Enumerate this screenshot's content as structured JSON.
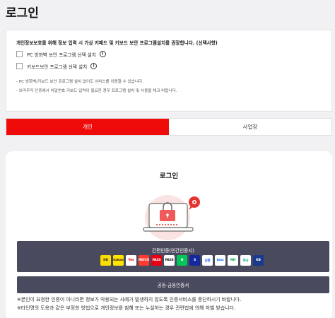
{
  "page": {
    "title": "로그인"
  },
  "notice": {
    "headline": "개인정보보호를 위해 정보 입력 시 가상 키패드 및 키보드 보안 프로그램설치를 권장합니다. (선택사항)",
    "options": [
      {
        "label": "PC 방화벽 보안 프로그램 선택 설치",
        "checked": false
      },
      {
        "label": "키보드보안 프로그램 선택 설치",
        "checked": false
      }
    ],
    "info_icon": "info-circle-icon",
    "bullets": [
      "- PC 방화벽/키보드 보안 프로그램 설치 없이도 서비스를 이용할 수 있습니다.",
      "- 브라우저 인증에서 비밀번호 키보드 입력이 필요한 경우 프로그램 설치 및 사용을 체크 바랍니다."
    ]
  },
  "tabs": [
    {
      "label": "개인",
      "active": true
    },
    {
      "label": "사업장",
      "active": false
    }
  ],
  "login": {
    "heading": "로그인",
    "illustration_icon": "laptop-lock-icon",
    "simple_auth": {
      "label": "간편인증(민간인증서)",
      "providers": [
        {
          "name": "KB",
          "bg": "#fbdc00",
          "fg": "#333"
        },
        {
          "name": "kakao",
          "bg": "#fee500",
          "fg": "#3c1e1e"
        },
        {
          "name": "Yes",
          "bg": "#ffffff",
          "fg": "#e60012"
        },
        {
          "name": "PAYCO",
          "bg": "#ff3b30",
          "fg": "#ffffff"
        },
        {
          "name": "PASS",
          "bg": "#e60012",
          "fg": "#ffffff"
        },
        {
          "name": "PASS",
          "bg": "#ffffff",
          "fg": "#222"
        },
        {
          "name": "N",
          "bg": "#03c75a",
          "fg": "#ffffff"
        },
        {
          "name": "S",
          "bg": "#1428a0",
          "fg": "#ffffff"
        },
        {
          "name": "신한",
          "bg": "#ffffff",
          "fg": "#0046ff"
        },
        {
          "name": "toss",
          "bg": "#ffffff",
          "fg": "#0064ff"
        },
        {
          "name": "NH",
          "bg": "#ffffff",
          "fg": "#00a651"
        },
        {
          "name": "하나",
          "bg": "#ffffff",
          "fg": "#00a37a"
        },
        {
          "name": "KB",
          "bg": "#1a3a8f",
          "fg": "#ffffff"
        }
      ]
    },
    "cert_auth": {
      "label": "공동·금융인증서"
    },
    "warnings": [
      "※본인이 요청한 인증이 아니라면 정보가 악용되는 사례가 발생하지 않도록 인증서비스를 중단하시기 바랍니다.",
      "※타인명의 도용과 같은 부정한 방법으로 개인정보를 침해 또는 누설하는 경우 관련법에 의해 처벌 받습니다."
    ]
  },
  "colors": {
    "accent_red": "#f00b0b",
    "dark_bar": "#4a4a5e",
    "badge_red": "#e8322f"
  }
}
